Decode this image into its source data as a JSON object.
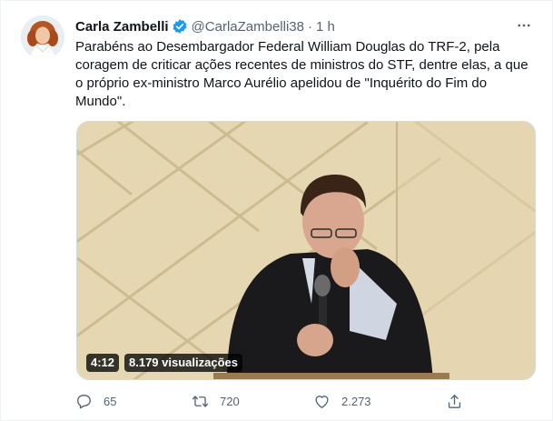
{
  "tweet": {
    "author_name": "Carla Zambelli",
    "handle": "@CarlaZambelli38",
    "separator": "·",
    "time": "1 h",
    "text": "Parabéns ao Desembargador Federal William Douglas do TRF-2, pela coragem de criticar ações recentes de ministros do STF, dentre elas, a que o próprio ex-ministro Marco Aurélio apelidou de \"Inquérito do Fim do Mundo\"."
  },
  "video": {
    "duration": "4:12",
    "views": "8.179 visualizações"
  },
  "actions": {
    "reply_count": "65",
    "retweet_count": "720",
    "like_count": "2.273"
  },
  "icons": {
    "verified": "verified-badge-icon",
    "more": "more-options-icon",
    "reply": "reply-icon",
    "retweet": "retweet-icon",
    "like": "heart-icon",
    "share": "share-icon"
  },
  "colors": {
    "verified_blue": "#1d9bf0",
    "text_primary": "#0f1419",
    "text_secondary": "#536471",
    "border": "#cfd9de"
  }
}
